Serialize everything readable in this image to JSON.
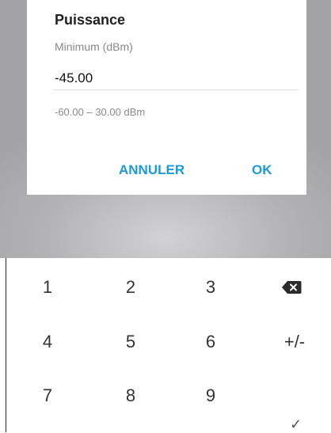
{
  "dialog": {
    "title": "Puissance",
    "field_label": "Minimum (dBm)",
    "field_value": "-45.00",
    "hint": "-60.00 – 30.00 dBm",
    "cancel_label": "ANNULER",
    "ok_label": "OK",
    "accent_color": "#1a9ad9"
  },
  "keypad": {
    "keys": [
      "1",
      "2",
      "3",
      "5",
      "4",
      "6",
      "+/-",
      "7",
      "8",
      "9"
    ],
    "row1": [
      "1",
      "2",
      "3"
    ],
    "row2": [
      "4",
      "5",
      "6",
      "+/-"
    ],
    "row3": [
      "7",
      "8",
      "9"
    ],
    "backspace_icon": "backspace-icon",
    "check_icon": "check-icon",
    "check_glyph": "✓"
  }
}
